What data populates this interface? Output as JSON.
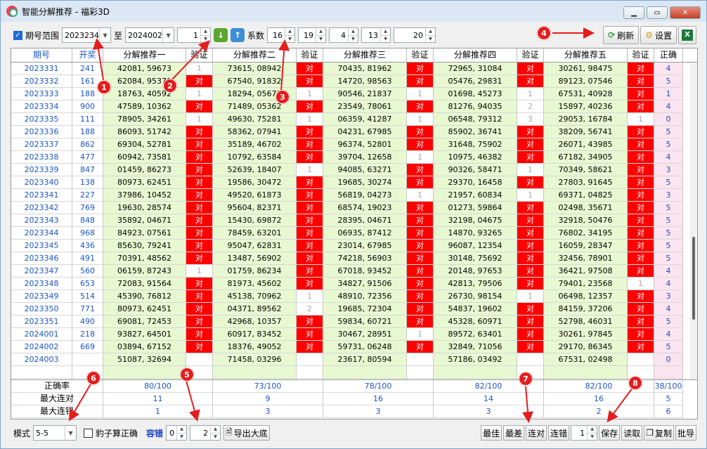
{
  "window": {
    "title": "智能分解推荐 - 福彩3D"
  },
  "toolbar": {
    "period_range_label": "期号范围",
    "period_from": "2023234",
    "to_label": "至",
    "period_to": "2024002",
    "count": "1",
    "coef_label": "系数",
    "coef_values": [
      "16",
      "19",
      "4",
      "13",
      "20"
    ],
    "refresh_label": "刷新",
    "settings_label": "设置"
  },
  "grid": {
    "headers": [
      "期号",
      "开奖",
      "分解推荐一",
      "验证",
      "分解推荐二",
      "验证",
      "分解推荐三",
      "验证",
      "分解推荐四",
      "验证",
      "分解推荐五",
      "验证",
      "正确"
    ],
    "rows": [
      [
        "2023331",
        "241",
        "42081, 59673",
        "1",
        "73615, 08942",
        "对",
        "70435, 81962",
        "对",
        "72965, 31084",
        "对",
        "30261, 98475",
        "对",
        "4"
      ],
      [
        "2023332",
        "161",
        "62084, 95371",
        "对",
        "67540, 91832",
        "对",
        "14720, 98563",
        "对",
        "05476, 29831",
        "对",
        "89123, 07546",
        "对",
        "5"
      ],
      [
        "2023333",
        "188",
        "18763, 40592",
        "1",
        "18294, 05673",
        "1",
        "90546, 21837",
        "1",
        "01698, 45273",
        "1",
        "67531, 40928",
        "对",
        "1"
      ],
      [
        "2023334",
        "900",
        "47589, 10362",
        "对",
        "71489, 05362",
        "对",
        "23549, 78061",
        "对",
        "81276, 94035",
        "2",
        "15897, 40236",
        "对",
        "4"
      ],
      [
        "2023335",
        "111",
        "78905, 34261",
        "1",
        "49630, 75281",
        "1",
        "06359, 41287",
        "1",
        "06548, 79312",
        "3",
        "29053, 16784",
        "1",
        "0"
      ],
      [
        "2023336",
        "188",
        "86093, 51742",
        "对",
        "58362, 07941",
        "对",
        "04231, 67985",
        "对",
        "85902, 36741",
        "对",
        "38209, 56741",
        "对",
        "5"
      ],
      [
        "2023337",
        "862",
        "69304, 52781",
        "对",
        "35189, 46702",
        "对",
        "96374, 52801",
        "对",
        "31648, 75902",
        "对",
        "26071, 43985",
        "对",
        "5"
      ],
      [
        "2023338",
        "477",
        "60942, 73581",
        "对",
        "10792, 63584",
        "对",
        "39704, 12658",
        "1",
        "10975, 46382",
        "对",
        "67182, 34905",
        "对",
        "4"
      ],
      [
        "2023339",
        "847",
        "01459, 86273",
        "对",
        "52639, 18407",
        "1",
        "94085, 63271",
        "对",
        "90326, 58471",
        "1",
        "70349, 58621",
        "对",
        "3"
      ],
      [
        "2023340",
        "138",
        "80973, 62451",
        "对",
        "19586, 30472",
        "对",
        "19685, 30274",
        "对",
        "29370, 16458",
        "对",
        "27803, 91645",
        "对",
        "5"
      ],
      [
        "2023341",
        "227",
        "37986, 10452",
        "对",
        "49520, 61873",
        "对",
        "56819, 04273",
        "1",
        "21957, 60834",
        "1",
        "69371, 04825",
        "对",
        "3"
      ],
      [
        "2023342",
        "769",
        "19630, 28574",
        "对",
        "95604, 82371",
        "对",
        "68574, 19023",
        "对",
        "01273, 59864",
        "对",
        "02498, 35671",
        "对",
        "5"
      ],
      [
        "2023343",
        "848",
        "35892, 04671",
        "对",
        "15430, 69872",
        "对",
        "28395, 04671",
        "对",
        "32198, 04675",
        "对",
        "32918, 50476",
        "对",
        "5"
      ],
      [
        "2023344",
        "968",
        "84923, 07561",
        "对",
        "78459, 63201",
        "对",
        "06935, 87412",
        "对",
        "14870, 93265",
        "对",
        "76802, 34195",
        "对",
        "5"
      ],
      [
        "2023345",
        "436",
        "85630, 79241",
        "对",
        "95047, 62831",
        "对",
        "23014, 67985",
        "对",
        "96087, 12354",
        "对",
        "16059, 28347",
        "对",
        "5"
      ],
      [
        "2023346",
        "491",
        "70391, 48562",
        "对",
        "13487, 56902",
        "对",
        "74218, 56903",
        "对",
        "30148, 75692",
        "对",
        "32456, 78901",
        "对",
        "5"
      ],
      [
        "2023347",
        "560",
        "06159, 87243",
        "1",
        "01759, 86234",
        "对",
        "67018, 93452",
        "对",
        "20148, 97653",
        "对",
        "36421, 97508",
        "对",
        "4"
      ],
      [
        "2023348",
        "653",
        "72083, 91564",
        "对",
        "81973, 45602",
        "对",
        "34827, 91506",
        "对",
        "42813, 79506",
        "对",
        "79401, 23568",
        "1",
        "4"
      ],
      [
        "2023349",
        "514",
        "45390, 76812",
        "对",
        "45138, 70962",
        "1",
        "48910, 72356",
        "对",
        "26730, 98154",
        "1",
        "06498, 12357",
        "对",
        "3"
      ],
      [
        "2023350",
        "771",
        "80973, 62451",
        "对",
        "04371, 89562",
        "2",
        "19685, 72304",
        "对",
        "54837, 19602",
        "对",
        "84159, 37206",
        "对",
        "4"
      ],
      [
        "2023351",
        "490",
        "69081, 72453",
        "对",
        "42968, 10357",
        "对",
        "59834, 60721",
        "对",
        "45328, 60971",
        "对",
        "52798, 46031",
        "对",
        "5"
      ],
      [
        "2024001",
        "218",
        "93827, 64501",
        "对",
        "60917, 83452",
        "对",
        "30467, 28951",
        "1",
        "89572, 63401",
        "对",
        "30261, 97845",
        "对",
        "4"
      ],
      [
        "2024002",
        "669",
        "03894, 67152",
        "对",
        "18376, 49052",
        "对",
        "59731, 06248",
        "对",
        "32849, 71056",
        "对",
        "29170, 86345",
        "对",
        "5"
      ],
      [
        "2024003",
        "",
        "51087, 32694",
        "",
        "71458, 03296",
        "",
        "23617, 80594",
        "",
        "57186, 03492",
        "",
        "67531, 02498",
        "",
        "0"
      ],
      [
        "",
        "",
        "",
        "",
        "",
        "",
        "",
        "",
        "",
        "",
        "",
        "",
        ""
      ],
      [
        "",
        "",
        "",
        "",
        "",
        "",
        "",
        "",
        "",
        "",
        "",
        "",
        ""
      ]
    ]
  },
  "stats": [
    {
      "label": "正确率",
      "values": [
        "80/100",
        "73/100",
        "78/100",
        "82/100",
        "82/100",
        "38/100"
      ]
    },
    {
      "label": "最大连对",
      "values": [
        "11",
        "9",
        "16",
        "14",
        "16",
        "5"
      ]
    },
    {
      "label": "最大连错",
      "values": [
        "1",
        "3",
        "3",
        "3",
        "2",
        "6"
      ]
    }
  ],
  "bottom": {
    "mode_label": "模式",
    "mode_value": "5-5",
    "chk_label": "豹子算正确",
    "tolerance_label": "容错",
    "tol_a": "0",
    "tol_b": "2",
    "export_label": "导出大底",
    "best_label": "最佳",
    "worst_label": "最差",
    "streak_ok_label": "连对",
    "streak_err_label": "连错",
    "streak_value": "1",
    "save_label": "保存",
    "load_label": "读取",
    "copy_label": "复制",
    "batch_label": "批导"
  },
  "callouts": [
    "1",
    "2",
    "3",
    "4",
    "5",
    "6",
    "7",
    "8"
  ],
  "colors": {
    "verify_red": "#ff0000",
    "rec_green": "#e8f9d2",
    "correct_pink": "#fbe4f0",
    "callout_red": "#e41d1d"
  }
}
